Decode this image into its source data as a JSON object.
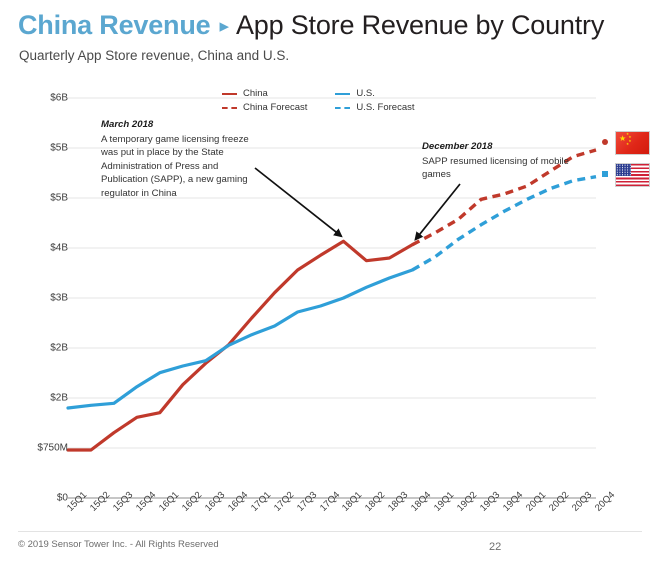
{
  "header": {
    "brand": "China Revenue",
    "separator": "▸",
    "title": "App Store Revenue by Country",
    "subtitle": "Quarterly App Store revenue, China and U.S.",
    "brand_color": "#5BA7D0",
    "title_color": "#231f20"
  },
  "legend": {
    "position": "top-center",
    "items": [
      {
        "label": "China",
        "color": "#C0392B",
        "style": "solid"
      },
      {
        "label": "U.S.",
        "color": "#2F9FD8",
        "style": "solid"
      },
      {
        "label": "China Forecast",
        "color": "#C0392B",
        "style": "dashed"
      },
      {
        "label": "U.S. Forecast",
        "color": "#2F9FD8",
        "style": "dashed"
      }
    ]
  },
  "annotations": [
    {
      "id": "march-2018",
      "title": "March 2018",
      "body": "A temporary game licensing freeze was put in place by the State Administration of Press and Publication (SAPP), a new gaming regulator in China",
      "arrow_target": "18Q1"
    },
    {
      "id": "december-2018",
      "title": "December 2018",
      "body": "SAPP resumed licensing of mobile games",
      "arrow_target": "18Q4"
    }
  ],
  "flags": [
    {
      "name": "china-flag",
      "label": "China",
      "marker_color": "#C0392B"
    },
    {
      "name": "us-flag",
      "label": "U.S.",
      "marker_color": "#2F9FD8"
    }
  ],
  "footer": {
    "copyright": "© 2019 Sensor Tower Inc. - All Rights Reserved",
    "page_number": "22"
  },
  "chart_data": {
    "type": "line",
    "title": "App Store Revenue by Country",
    "subtitle": "Quarterly App Store revenue, China and U.S.",
    "xlabel": "",
    "ylabel": "",
    "grid": true,
    "legend_position": "top-center",
    "ylim": [
      0,
      6000
    ],
    "ytick_values": [
      0,
      750,
      1500,
      2250,
      3000,
      3750,
      4500,
      5250,
      6000
    ],
    "ytick_labels": [
      "$0",
      "$750M",
      "$2B",
      "$2B",
      "$3B",
      "$4B",
      "$5B",
      "$5B",
      "$6B"
    ],
    "units": "USD millions",
    "categories": [
      "15Q1",
      "15Q2",
      "15Q3",
      "15Q4",
      "16Q1",
      "16Q2",
      "16Q3",
      "16Q4",
      "17Q1",
      "17Q2",
      "17Q3",
      "17Q4",
      "18Q1",
      "18Q2",
      "18Q3",
      "18Q4",
      "19Q1",
      "19Q2",
      "19Q3",
      "19Q4",
      "20Q1",
      "20Q2",
      "20Q3",
      "20Q4"
    ],
    "forecast_start_index": 15,
    "series": [
      {
        "name": "China",
        "color": "#C0392B",
        "values": [
          720,
          720,
          980,
          1210,
          1280,
          1700,
          2020,
          2300,
          2700,
          3080,
          3420,
          3640,
          3850,
          3560,
          3600,
          3800,
          3980,
          4180,
          4480,
          4560,
          4680,
          4900,
          5120,
          5220
        ],
        "actual_through": "18Q4",
        "forecast_from": "18Q4"
      },
      {
        "name": "U.S.",
        "color": "#2F9FD8",
        "values": [
          1350,
          1390,
          1420,
          1670,
          1880,
          1980,
          2060,
          2290,
          2450,
          2580,
          2790,
          2880,
          3000,
          3160,
          3300,
          3420,
          3620,
          3880,
          4100,
          4300,
          4480,
          4640,
          4760,
          4820
        ],
        "actual_through": "18Q4",
        "forecast_from": "18Q4"
      }
    ]
  }
}
